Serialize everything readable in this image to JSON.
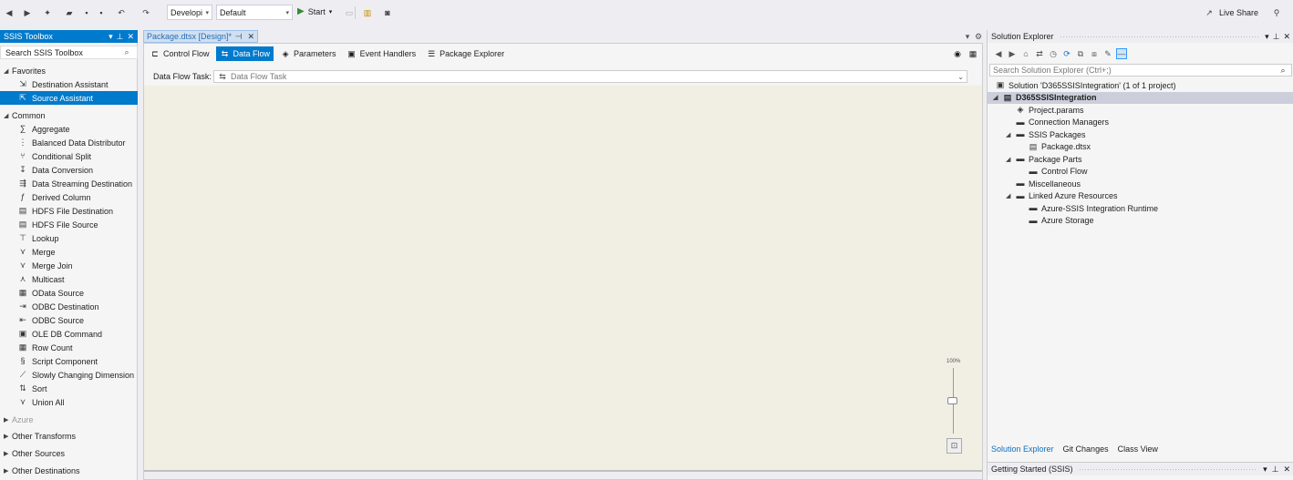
{
  "toolbar": {
    "config": "Developi",
    "platform": "Default",
    "start": "Start",
    "live_share": "Live Share"
  },
  "toolbox": {
    "title": "SSIS Toolbox",
    "search_placeholder": "Search SSIS Toolbox",
    "rows": [
      {
        "type": "cat",
        "label": "Favorites",
        "open": true
      },
      {
        "type": "item",
        "label": "Destination Assistant",
        "icon": "destination-assistant-icon",
        "glyph": "⇲"
      },
      {
        "type": "item",
        "label": "Source Assistant",
        "icon": "source-assistant-icon",
        "glyph": "⇱",
        "selected": true
      },
      {
        "type": "cat",
        "label": "Common",
        "open": true
      },
      {
        "type": "item",
        "label": "Aggregate",
        "icon": "aggregate-icon",
        "glyph": "∑"
      },
      {
        "type": "item",
        "label": "Balanced Data Distributor",
        "icon": "distributor-icon",
        "glyph": "⋮"
      },
      {
        "type": "item",
        "label": "Conditional Split",
        "icon": "split-icon",
        "glyph": "⑂"
      },
      {
        "type": "item",
        "label": "Data Conversion",
        "icon": "conversion-icon",
        "glyph": "↧"
      },
      {
        "type": "item",
        "label": "Data Streaming Destination",
        "icon": "streaming-icon",
        "glyph": "⇶"
      },
      {
        "type": "item",
        "label": "Derived Column",
        "icon": "derived-column-icon",
        "glyph": "ƒ"
      },
      {
        "type": "item",
        "label": "HDFS File Destination",
        "icon": "hdfs-destination-icon",
        "glyph": "▤"
      },
      {
        "type": "item",
        "label": "HDFS File Source",
        "icon": "hdfs-source-icon",
        "glyph": "▤"
      },
      {
        "type": "item",
        "label": "Lookup",
        "icon": "lookup-icon",
        "glyph": "⊤"
      },
      {
        "type": "item",
        "label": "Merge",
        "icon": "merge-icon",
        "glyph": "⋎"
      },
      {
        "type": "item",
        "label": "Merge Join",
        "icon": "merge-join-icon",
        "glyph": "⋎"
      },
      {
        "type": "item",
        "label": "Multicast",
        "icon": "multicast-icon",
        "glyph": "⋏"
      },
      {
        "type": "item",
        "label": "OData Source",
        "icon": "odata-icon",
        "glyph": "▦"
      },
      {
        "type": "item",
        "label": "ODBC Destination",
        "icon": "odbc-destination-icon",
        "glyph": "⇥"
      },
      {
        "type": "item",
        "label": "ODBC Source",
        "icon": "odbc-source-icon",
        "glyph": "⇤"
      },
      {
        "type": "item",
        "label": "OLE DB Command",
        "icon": "oledb-command-icon",
        "glyph": "▣"
      },
      {
        "type": "item",
        "label": "Row Count",
        "icon": "row-count-icon",
        "glyph": "▦"
      },
      {
        "type": "item",
        "label": "Script Component",
        "icon": "script-icon",
        "glyph": "§"
      },
      {
        "type": "item",
        "label": "Slowly Changing Dimension",
        "icon": "scd-icon",
        "glyph": "⟋"
      },
      {
        "type": "item",
        "label": "Sort",
        "icon": "sort-icon",
        "glyph": "⇅"
      },
      {
        "type": "item",
        "label": "Union All",
        "icon": "union-all-icon",
        "glyph": "⋎"
      },
      {
        "type": "cat",
        "label": "Azure",
        "open": false,
        "dim": true
      },
      {
        "type": "cat",
        "label": "Other Transforms",
        "open": false
      },
      {
        "type": "cat",
        "label": "Other Sources",
        "open": false
      },
      {
        "type": "cat",
        "label": "Other Destinations",
        "open": false
      }
    ]
  },
  "document_tab": {
    "title": "Package.dtsx [Design]*"
  },
  "designer": {
    "tabs": [
      {
        "label": "Control Flow",
        "icon": "control-flow-icon",
        "glyph": "⊏"
      },
      {
        "label": "Data Flow",
        "icon": "data-flow-icon",
        "glyph": "⇆",
        "active": true
      },
      {
        "label": "Parameters",
        "icon": "parameters-icon",
        "glyph": "◈"
      },
      {
        "label": "Event Handlers",
        "icon": "event-handlers-icon",
        "glyph": "▣"
      },
      {
        "label": "Package Explorer",
        "icon": "package-explorer-icon",
        "glyph": "☰"
      }
    ],
    "task_label": "Data Flow Task:",
    "task_value": "Data Flow Task",
    "zoom": "100%"
  },
  "solution_explorer": {
    "title": "Solution Explorer",
    "search_placeholder": "Search Solution Explorer (Ctrl+;)",
    "tree": [
      {
        "label": "Solution 'D365SSISIntegration' (1 of 1 project)",
        "depth": 0,
        "icon": "solution-icon",
        "glyph": "▣"
      },
      {
        "label": "D365SSISIntegration",
        "depth": 1,
        "icon": "project-icon",
        "glyph": "▤",
        "expand": "◢",
        "selected": true
      },
      {
        "label": "Project.params",
        "depth": 2,
        "icon": "params-icon",
        "glyph": "◈"
      },
      {
        "label": "Connection Managers",
        "depth": 2,
        "icon": "folder-icon",
        "glyph": "▬"
      },
      {
        "label": "SSIS Packages",
        "depth": 2,
        "icon": "folder-icon",
        "glyph": "▬",
        "expand": "◢"
      },
      {
        "label": "Package.dtsx",
        "depth": 3,
        "icon": "package-icon",
        "glyph": "▤"
      },
      {
        "label": "Package Parts",
        "depth": 2,
        "icon": "folder-icon",
        "glyph": "▬",
        "expand": "◢"
      },
      {
        "label": "Control Flow",
        "depth": 3,
        "icon": "folder-icon",
        "glyph": "▬"
      },
      {
        "label": "Miscellaneous",
        "depth": 2,
        "icon": "folder-icon",
        "glyph": "▬"
      },
      {
        "label": "Linked Azure Resources",
        "depth": 2,
        "icon": "folder-icon",
        "glyph": "▬",
        "expand": "◢"
      },
      {
        "label": "Azure-SSIS Integration Runtime",
        "depth": 3,
        "icon": "folder-icon",
        "glyph": "▬"
      },
      {
        "label": "Azure Storage",
        "depth": 3,
        "icon": "folder-icon",
        "glyph": "▬"
      }
    ],
    "bottom_tabs": [
      {
        "label": "Solution Explorer",
        "active": true
      },
      {
        "label": "Git Changes"
      },
      {
        "label": "Class View"
      }
    ]
  },
  "getting_started": {
    "title": "Getting Started (SSIS)"
  }
}
